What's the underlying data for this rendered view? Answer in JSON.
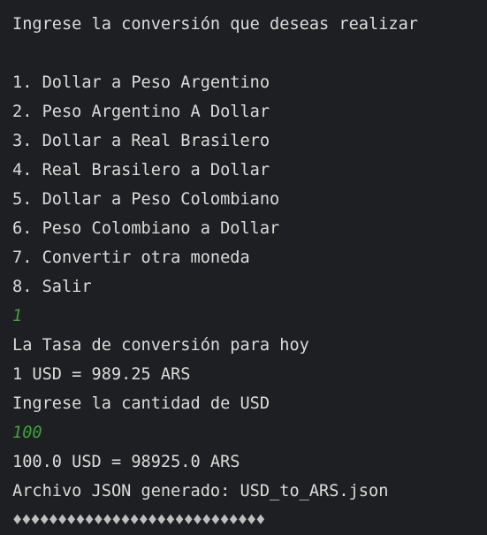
{
  "console": {
    "prompt_title": "Ingrese la conversión que deseas realizar",
    "menu": [
      "1. Dollar a Peso Argentino",
      "2. Peso Argentino A Dollar",
      "3. Dollar a Real Brasilero",
      "4. Real Brasilero a Dollar",
      "5. Dollar a Peso Colombiano",
      "6. Peso Colombiano a Dollar",
      "7. Convertir otra moneda",
      "8. Salir"
    ],
    "user_choice": "1",
    "rate_title": "La Tasa de conversión para hoy",
    "rate_value": "1 USD = 989.25 ARS",
    "amount_prompt": "Ingrese la cantidad de USD",
    "user_amount": "100",
    "result": "100.0 USD = 98925.0 ARS",
    "file_message": "Archivo JSON generado: USD_to_ARS.json",
    "garbled_output": "♦♦♦♦♦♦♦♦♦♦♦♦♦♦♦♦♦♦♦♦♦♦♦♦♦♦♦♦"
  },
  "colors": {
    "background": "#1e1f22",
    "text": "#dcdcdc",
    "user_input": "#3fa23a"
  }
}
